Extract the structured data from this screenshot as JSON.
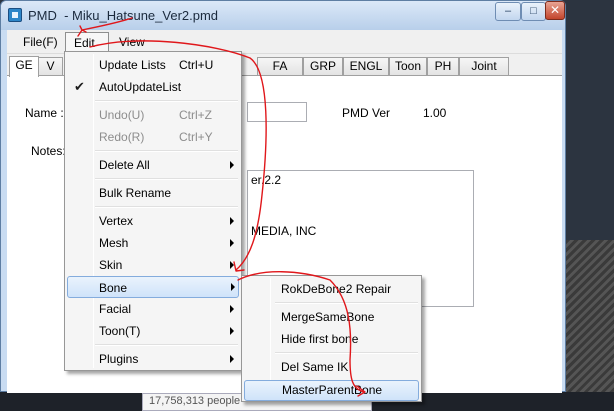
{
  "window": {
    "title": "PMD  - Miku_Hatsune_Ver2.pmd",
    "minimize_glyph": "–",
    "maximize_glyph": "□",
    "close_glyph": "✕"
  },
  "menubar": {
    "file": "File(F)",
    "edit": "Edit",
    "view": "View"
  },
  "tabs": [
    "GE",
    "V",
    "FA",
    "GRP",
    "ENGL",
    "Toon",
    "PH",
    "Joint"
  ],
  "form": {
    "name_label": "Name :",
    "pmd_ver_label": "PMD Ver",
    "pmd_ver_value": "1.00",
    "notes_label": "Notes:",
    "notes_lines": [
      "er.2.2",
      "MEDIA, INC"
    ]
  },
  "edit_menu": {
    "update_lists": "Update Lists",
    "update_lists_key": "Ctrl+U",
    "auto_update_list": "AutoUpdateList",
    "undo": "Undo(U)",
    "undo_key": "Ctrl+Z",
    "redo": "Redo(R)",
    "redo_key": "Ctrl+Y",
    "delete_all": "Delete All",
    "bulk_rename": "Bulk Rename",
    "vertex": "Vertex",
    "mesh": "Mesh",
    "skin": "Skin",
    "bone": "Bone",
    "facial": "Facial",
    "toon": "Toon(T)",
    "plugins": "Plugins"
  },
  "bone_submenu": {
    "rokdebone2_repair": "RokDeBone2 Repair",
    "merge_same_bone": "MergeSameBone",
    "hide_first_bone": "Hide first bone",
    "del_same_ik": "Del Same IK",
    "master_parent_bone": "MasterParentBone"
  },
  "background": {
    "status_text": "17,758,313 people"
  },
  "colors": {
    "annotation": "#e0171b",
    "highlight": "#cfe3fa",
    "title_bar": "#c9dcf2"
  }
}
